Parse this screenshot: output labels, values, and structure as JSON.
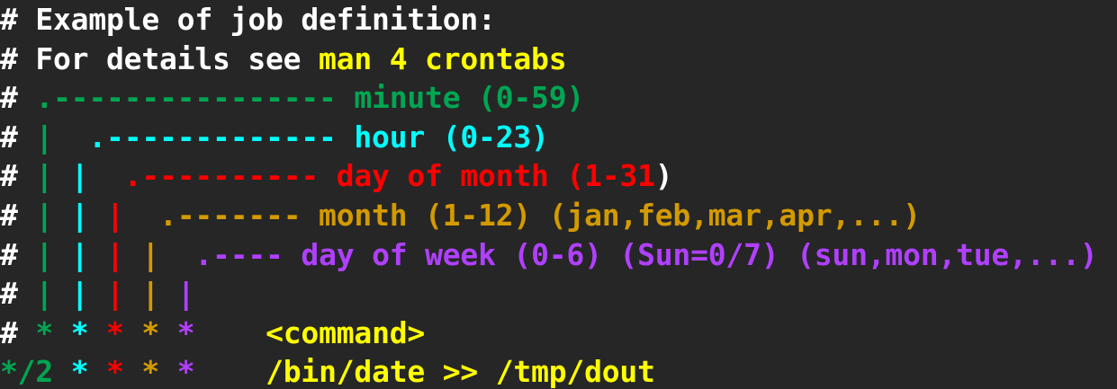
{
  "colors": {
    "background": "#262626",
    "default": "#ffffff",
    "yellow": "#ffff00",
    "green": "#00a652",
    "cyan": "#00ffff",
    "red": "#ff0000",
    "orange": "#d39a00",
    "purple": "#b040ff"
  },
  "lines": [
    [
      {
        "text": "# Example of job definition:",
        "color": "default"
      }
    ],
    [
      {
        "text": "# For details see ",
        "color": "default"
      },
      {
        "text": "man 4 crontabs",
        "color": "yellow"
      }
    ],
    [
      {
        "text": "# ",
        "color": "default"
      },
      {
        "text": ".---------------- minute (0-59)",
        "color": "green"
      }
    ],
    [
      {
        "text": "# ",
        "color": "default"
      },
      {
        "text": "|",
        "color": "green"
      },
      {
        "text": "  ",
        "color": "default"
      },
      {
        "text": ".------------- ",
        "color": "cyan"
      },
      {
        "text": "hour (0-23)",
        "color": "cyan"
      }
    ],
    [
      {
        "text": "# ",
        "color": "default"
      },
      {
        "text": "|",
        "color": "green"
      },
      {
        "text": " ",
        "color": "default"
      },
      {
        "text": "|",
        "color": "cyan"
      },
      {
        "text": "  ",
        "color": "default"
      },
      {
        "text": ".---------- day of month (1-31",
        "color": "red"
      },
      {
        "text": ")",
        "color": "default"
      }
    ],
    [
      {
        "text": "# ",
        "color": "default"
      },
      {
        "text": "|",
        "color": "green"
      },
      {
        "text": " ",
        "color": "default"
      },
      {
        "text": "|",
        "color": "cyan"
      },
      {
        "text": " ",
        "color": "default"
      },
      {
        "text": "|",
        "color": "red"
      },
      {
        "text": "  ",
        "color": "default"
      },
      {
        "text": ".------- month (1-12) (jan,feb,mar,apr,...)",
        "color": "orange"
      }
    ],
    [
      {
        "text": "# ",
        "color": "default"
      },
      {
        "text": "|",
        "color": "green"
      },
      {
        "text": " ",
        "color": "default"
      },
      {
        "text": "|",
        "color": "cyan"
      },
      {
        "text": " ",
        "color": "default"
      },
      {
        "text": "|",
        "color": "red"
      },
      {
        "text": " ",
        "color": "default"
      },
      {
        "text": "|",
        "color": "orange"
      },
      {
        "text": "  ",
        "color": "default"
      },
      {
        "text": ".---- day of week (0-6) (Sun=0/7) (sun,mon,tue,...)",
        "color": "purple"
      }
    ],
    [
      {
        "text": "# ",
        "color": "default"
      },
      {
        "text": "|",
        "color": "green"
      },
      {
        "text": " ",
        "color": "default"
      },
      {
        "text": "|",
        "color": "cyan"
      },
      {
        "text": " ",
        "color": "default"
      },
      {
        "text": "|",
        "color": "red"
      },
      {
        "text": " ",
        "color": "default"
      },
      {
        "text": "|",
        "color": "orange"
      },
      {
        "text": " ",
        "color": "default"
      },
      {
        "text": "|",
        "color": "purple"
      }
    ],
    [
      {
        "text": "# ",
        "color": "default"
      },
      {
        "text": "*",
        "color": "green"
      },
      {
        "text": " ",
        "color": "default"
      },
      {
        "text": "*",
        "color": "cyan"
      },
      {
        "text": " ",
        "color": "default"
      },
      {
        "text": "*",
        "color": "red"
      },
      {
        "text": " ",
        "color": "default"
      },
      {
        "text": "*",
        "color": "orange"
      },
      {
        "text": " ",
        "color": "default"
      },
      {
        "text": "*",
        "color": "purple"
      },
      {
        "text": "    ",
        "color": "default"
      },
      {
        "text": "<command>",
        "color": "yellow"
      }
    ],
    [
      {
        "text": "*/2",
        "color": "green"
      },
      {
        "text": " ",
        "color": "default"
      },
      {
        "text": "*",
        "color": "cyan"
      },
      {
        "text": " ",
        "color": "default"
      },
      {
        "text": "*",
        "color": "red"
      },
      {
        "text": " ",
        "color": "default"
      },
      {
        "text": "*",
        "color": "orange"
      },
      {
        "text": " ",
        "color": "default"
      },
      {
        "text": "*",
        "color": "purple"
      },
      {
        "text": "    ",
        "color": "default"
      },
      {
        "text": "/bin/date >> /tmp/dout",
        "color": "yellow"
      }
    ]
  ]
}
